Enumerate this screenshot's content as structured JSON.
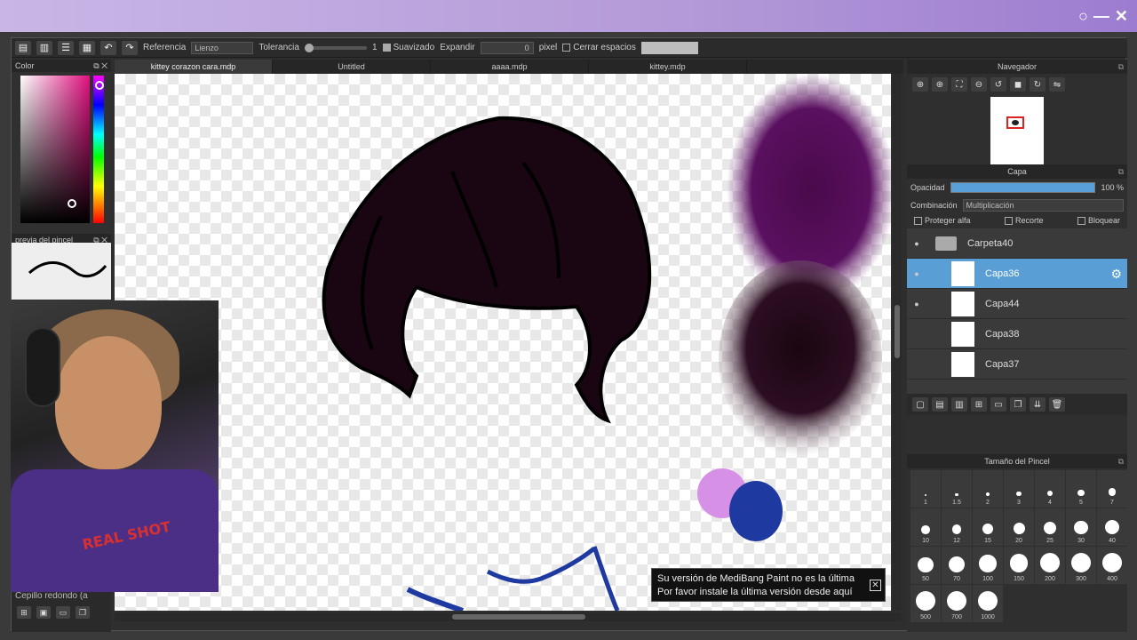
{
  "window": {
    "controls": [
      "○",
      "—",
      "✕"
    ]
  },
  "toolbar": {
    "undo_icon": "undo-icon",
    "redo_icon": "redo-icon",
    "reference_label": "Referencia",
    "reference_value": "Lienzo",
    "tolerance_label": "Tolerancia",
    "tolerance_value": "1",
    "antialias_label": "Suavizado",
    "expand_label": "Expandir",
    "expand_value": "0",
    "pixel_label": "pixel",
    "close_gaps_label": "Cerrar espacios"
  },
  "color_panel": {
    "title": "Color",
    "hue_color": "#e0107f"
  },
  "brush_preview": {
    "title": "previa del pincel"
  },
  "tabs": [
    {
      "label": "kittey corazon cara.mdp",
      "active": true
    },
    {
      "label": "Untitled",
      "active": false
    },
    {
      "label": "aaaa.mdp",
      "active": false
    },
    {
      "label": "kittey.mdp",
      "active": false
    }
  ],
  "webcam": {
    "shirt_text": "REAL SHOT"
  },
  "left_bottom": {
    "brush_label": "Cepillo redondo (a"
  },
  "toast": {
    "line1": "Su versión de MediBang Paint no es la última",
    "line2": "Por favor instale la última versión desde aquí"
  },
  "navigator": {
    "title": "Navegador"
  },
  "layer_panel": {
    "title": "Capa",
    "opacity_label": "Opacidad",
    "opacity_value": "100 %",
    "blend_label": "Combinación",
    "blend_value": "Multiplicación",
    "protect_alpha": "Proteger alfa",
    "clipping": "Recorte",
    "lock": "Bloquear",
    "layers": [
      {
        "name": "Carpeta40",
        "type": "folder",
        "visible": true,
        "selected": false
      },
      {
        "name": "Capa36",
        "type": "layer",
        "visible": true,
        "selected": true
      },
      {
        "name": "Capa44",
        "type": "layer",
        "visible": true,
        "selected": false
      },
      {
        "name": "Capa38",
        "type": "layer",
        "visible": false,
        "selected": false
      },
      {
        "name": "Capa37",
        "type": "layer",
        "visible": false,
        "selected": false
      }
    ]
  },
  "brush_size": {
    "title": "Tamaño del Pincel",
    "sizes": [
      "1",
      "1.5",
      "2",
      "3",
      "4",
      "5",
      "7",
      "10",
      "12",
      "15",
      "20",
      "25",
      "30",
      "40",
      "50",
      "70",
      "100",
      "150",
      "200",
      "300",
      "400",
      "500",
      "700",
      "1000"
    ]
  }
}
